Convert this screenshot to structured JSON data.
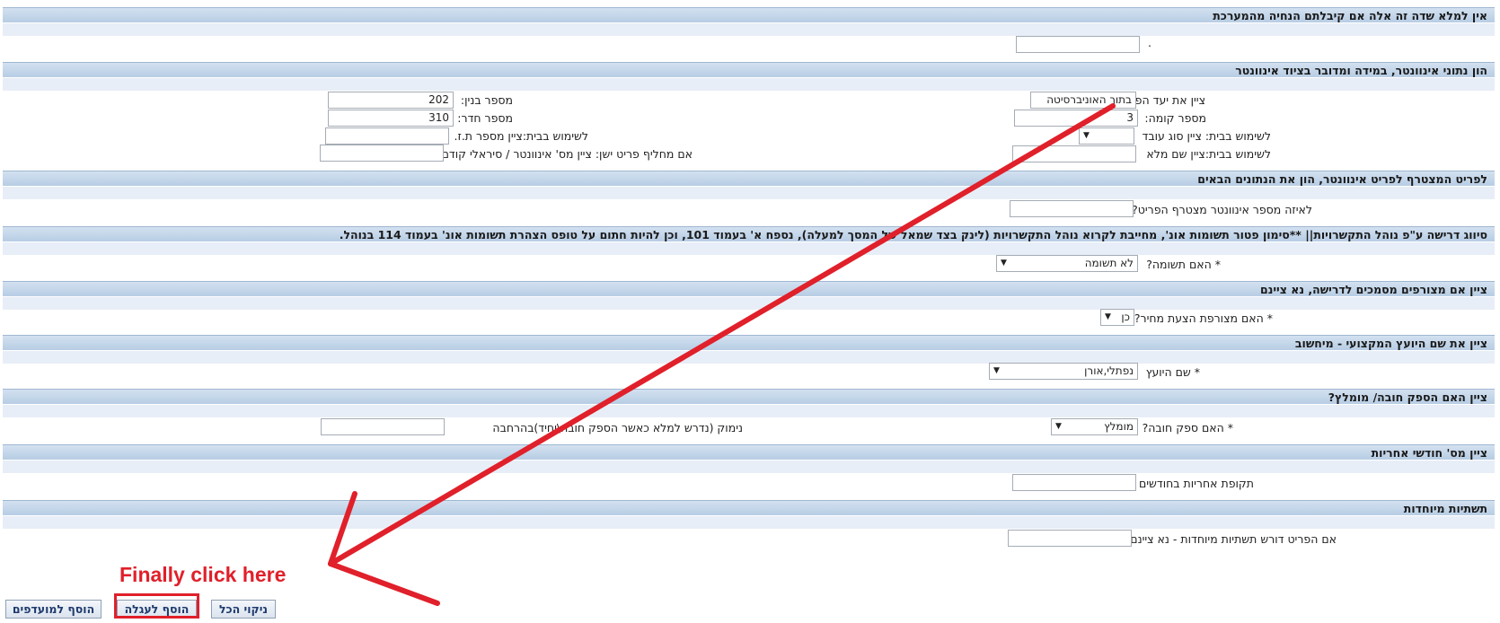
{
  "sections": {
    "s1": {
      "title": "אין למלא שדה זה אלה אם קיבלתם הנחיה מהמערכת",
      "dot": "."
    },
    "s2": {
      "title": "הון נתוני אינוונטר, במידה ומדובר בציוד אינוונטר",
      "item_purpose_label": "ציין את יעד הפריט",
      "item_purpose_value": "בתוך האוניברסיטה",
      "floor_label": "מספר קומה:",
      "floor_value": "3",
      "home_worker_type_label": "לשימוש בבית: ציין סוג עובד",
      "home_full_name_label": "לשימוש בבית:ציין שם מלא",
      "building_label": "מספר בנין:",
      "building_value": "202",
      "room_label": "מספר חדר:",
      "room_value": "310",
      "home_id_label": "לשימוש בבית:ציין מספר ת.ז.",
      "old_item_label": "אם מחליף פריט ישן: ציין מס' אינוונטר / סיראלי קודם"
    },
    "s3": {
      "title": "לפריט המצטרף לפריט אינוונטר, הון את הנתונים הבאים",
      "attached_label": "לאיזה מספר אינוונטר מצטרף הפריט?"
    },
    "s4": {
      "title": "סיווג דרישה ע\"פ נוהל התקשרויות|| **סימון פטור תשומות אונ', מחייבת לקרוא נוהל התקשרויות (לינק בצד שמאל של המסך למעלה), נספח א' בעמוד 101, וכן להיות חתום על טופס הצהרת תשומות אונ' בעמוד 114 בנוהל.",
      "input_label": "* האם תשומה?",
      "input_value": "לא תשומה"
    },
    "s5": {
      "title": "ציין אם מצורפים מסמכים לדרישה, נא ציינם",
      "quote_label": "* האם מצורפת הצעת מחיר?",
      "quote_value": "כן"
    },
    "s6": {
      "title": "ציין את שם היועץ המקצועי - מיחשוב",
      "advisor_label": "* שם היועץ",
      "advisor_value": "נפתלי,אורן"
    },
    "s7": {
      "title": "ציין האם הספק חובה/ מומלץ?",
      "supplier_label": "* האם ספק חובה?",
      "supplier_value": "מומלץ",
      "reason_label": "נימוק (נדרש למלא כאשר הספק חובה\\יחיד)בהרחבה"
    },
    "s8": {
      "title": "ציין מס' חודשי אחריות",
      "warranty_label": "תקופת אחריות בחודשים"
    },
    "s9": {
      "title": "תשתיות מיוחדות",
      "infra_label": "אם הפריט דורש תשתיות מיוחדות - נא ציינם"
    }
  },
  "buttons": {
    "clear_all": "ניקוי הכל",
    "add_to_cart": "הוסף לעגלה",
    "add_to_favorites": "הוסף למועדפים"
  },
  "annotation": {
    "text": "Finally click here",
    "color": "#e0202a"
  },
  "icons": {
    "dropdown": "▼"
  }
}
